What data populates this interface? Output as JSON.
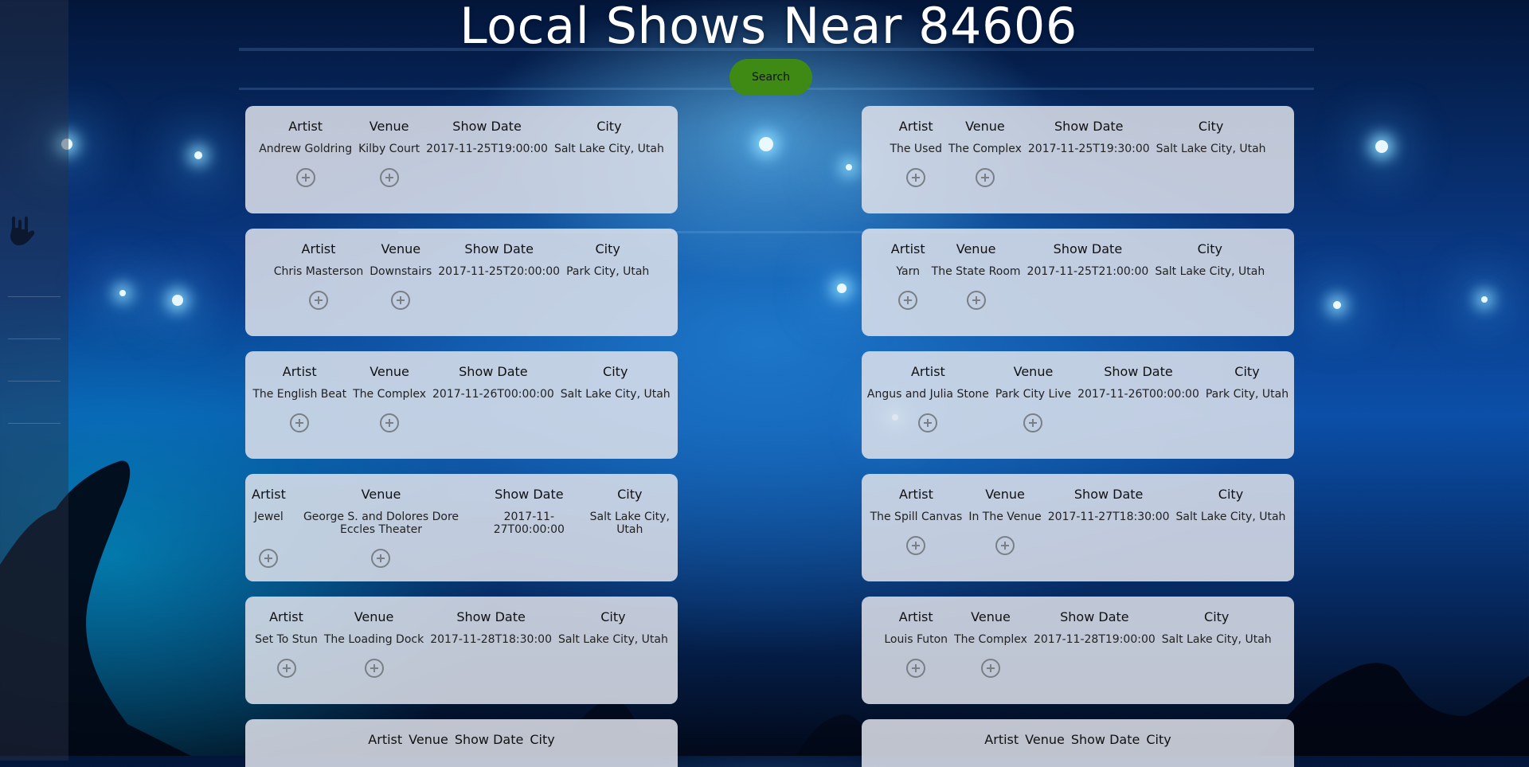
{
  "title": "Local Shows Near 84606",
  "search_label": "Search",
  "headers": {
    "artist": "Artist",
    "venue": "Venue",
    "date": "Show Date",
    "city": "City"
  },
  "shows": [
    {
      "artist": "Andrew Goldring",
      "venue": "Kilby Court",
      "date": "2017-11-25T19:00:00",
      "city": "Salt Lake City, Utah"
    },
    {
      "artist": "The Used",
      "venue": "The Complex",
      "date": "2017-11-25T19:30:00",
      "city": "Salt Lake City, Utah"
    },
    {
      "artist": "Chris Masterson",
      "venue": "Downstairs",
      "date": "2017-11-25T20:00:00",
      "city": "Park City, Utah"
    },
    {
      "artist": "Yarn",
      "venue": "The State Room",
      "date": "2017-11-25T21:00:00",
      "city": "Salt Lake City, Utah"
    },
    {
      "artist": "The English Beat",
      "venue": "The Complex",
      "date": "2017-11-26T00:00:00",
      "city": "Salt Lake City, Utah"
    },
    {
      "artist": "Angus and Julia Stone",
      "venue": "Park City Live",
      "date": "2017-11-26T00:00:00",
      "city": "Park City, Utah"
    },
    {
      "artist": "Jewel",
      "venue": "George S. and Dolores Dore Eccles Theater",
      "date": "2017-11-27T00:00:00",
      "city": "Salt Lake City, Utah"
    },
    {
      "artist": "The Spill Canvas",
      "venue": "In The Venue",
      "date": "2017-11-27T18:30:00",
      "city": "Salt Lake City, Utah"
    },
    {
      "artist": "Set To Stun",
      "venue": "The Loading Dock",
      "date": "2017-11-28T18:30:00",
      "city": "Salt Lake City, Utah"
    },
    {
      "artist": "Louis Futon",
      "venue": "The Complex",
      "date": "2017-11-28T19:00:00",
      "city": "Salt Lake City, Utah"
    },
    {
      "artist": "",
      "venue": "",
      "date": "",
      "city": ""
    },
    {
      "artist": "",
      "venue": "",
      "date": "",
      "city": ""
    }
  ],
  "icons": {
    "add": "plus-circle-icon",
    "logo": "rock-hand-icon"
  },
  "colors": {
    "search_button": "#3f8a14",
    "card_bg": "#dee2eb"
  }
}
